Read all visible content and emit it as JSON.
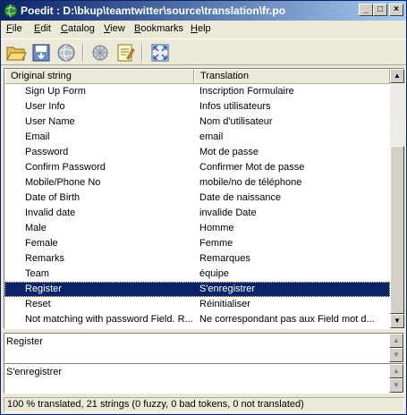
{
  "window": {
    "title": "Poedit : D:\\bkup\\teamtwitter\\source\\translation\\fr.po",
    "controls": {
      "minimize": "_",
      "maximize": "□",
      "close": "×"
    }
  },
  "menu": [
    {
      "label": "File",
      "accel": "F",
      "rest": "ile"
    },
    {
      "label": "Edit",
      "accel": "E",
      "rest": "dit"
    },
    {
      "label": "Catalog",
      "accel": "C",
      "rest": "atalog"
    },
    {
      "label": "View",
      "accel": "V",
      "rest": "iew"
    },
    {
      "label": "Bookmarks",
      "accel": "B",
      "rest": "ookmarks"
    },
    {
      "label": "Help",
      "accel": "H",
      "rest": "elp"
    }
  ],
  "toolbar": {
    "icons": [
      "open-folder-icon",
      "save-icon",
      "update-catalog-icon",
      "validate-icon",
      "comment-icon",
      "fullscreen-icon"
    ]
  },
  "list": {
    "columns": {
      "original": "Original string",
      "translation": "Translation"
    },
    "rows": [
      {
        "original": "Sign Up Form",
        "translation": "Inscription Formulaire"
      },
      {
        "original": "User Info",
        "translation": "Infos utilisateurs"
      },
      {
        "original": "User Name",
        "translation": "Nom d'utilisateur"
      },
      {
        "original": "Email",
        "translation": "email"
      },
      {
        "original": "Password",
        "translation": "Mot de passe"
      },
      {
        "original": "Confirm Password",
        "translation": "Confirmer Mot de passe"
      },
      {
        "original": "Mobile/Phone No",
        "translation": "mobile/no de téléphone"
      },
      {
        "original": "Date of Birth",
        "translation": "Date de naissance"
      },
      {
        "original": "Invalid date",
        "translation": "invalide Date"
      },
      {
        "original": "Male",
        "translation": "Homme"
      },
      {
        "original": "Female",
        "translation": "Femme"
      },
      {
        "original": "Remarks",
        "translation": "Remarques"
      },
      {
        "original": "Team",
        "translation": "équipe"
      },
      {
        "original": "Register",
        "translation": "S'enregistrer"
      },
      {
        "original": "Reset",
        "translation": "Réinitialiser"
      },
      {
        "original": "Not matching with password Field. R...",
        "translation": "Ne correspondant pas aux Field mot d..."
      }
    ],
    "selected_index": 13
  },
  "source_text": "Register",
  "translation_text": "S'enregistrer",
  "status": "100 % translated, 21 strings (0 fuzzy, 0 bad tokens, 0 not translated)",
  "colors": {
    "selection": "#0a246a",
    "titlebar_start": "#0a246a",
    "titlebar_end": "#a6caf0"
  }
}
